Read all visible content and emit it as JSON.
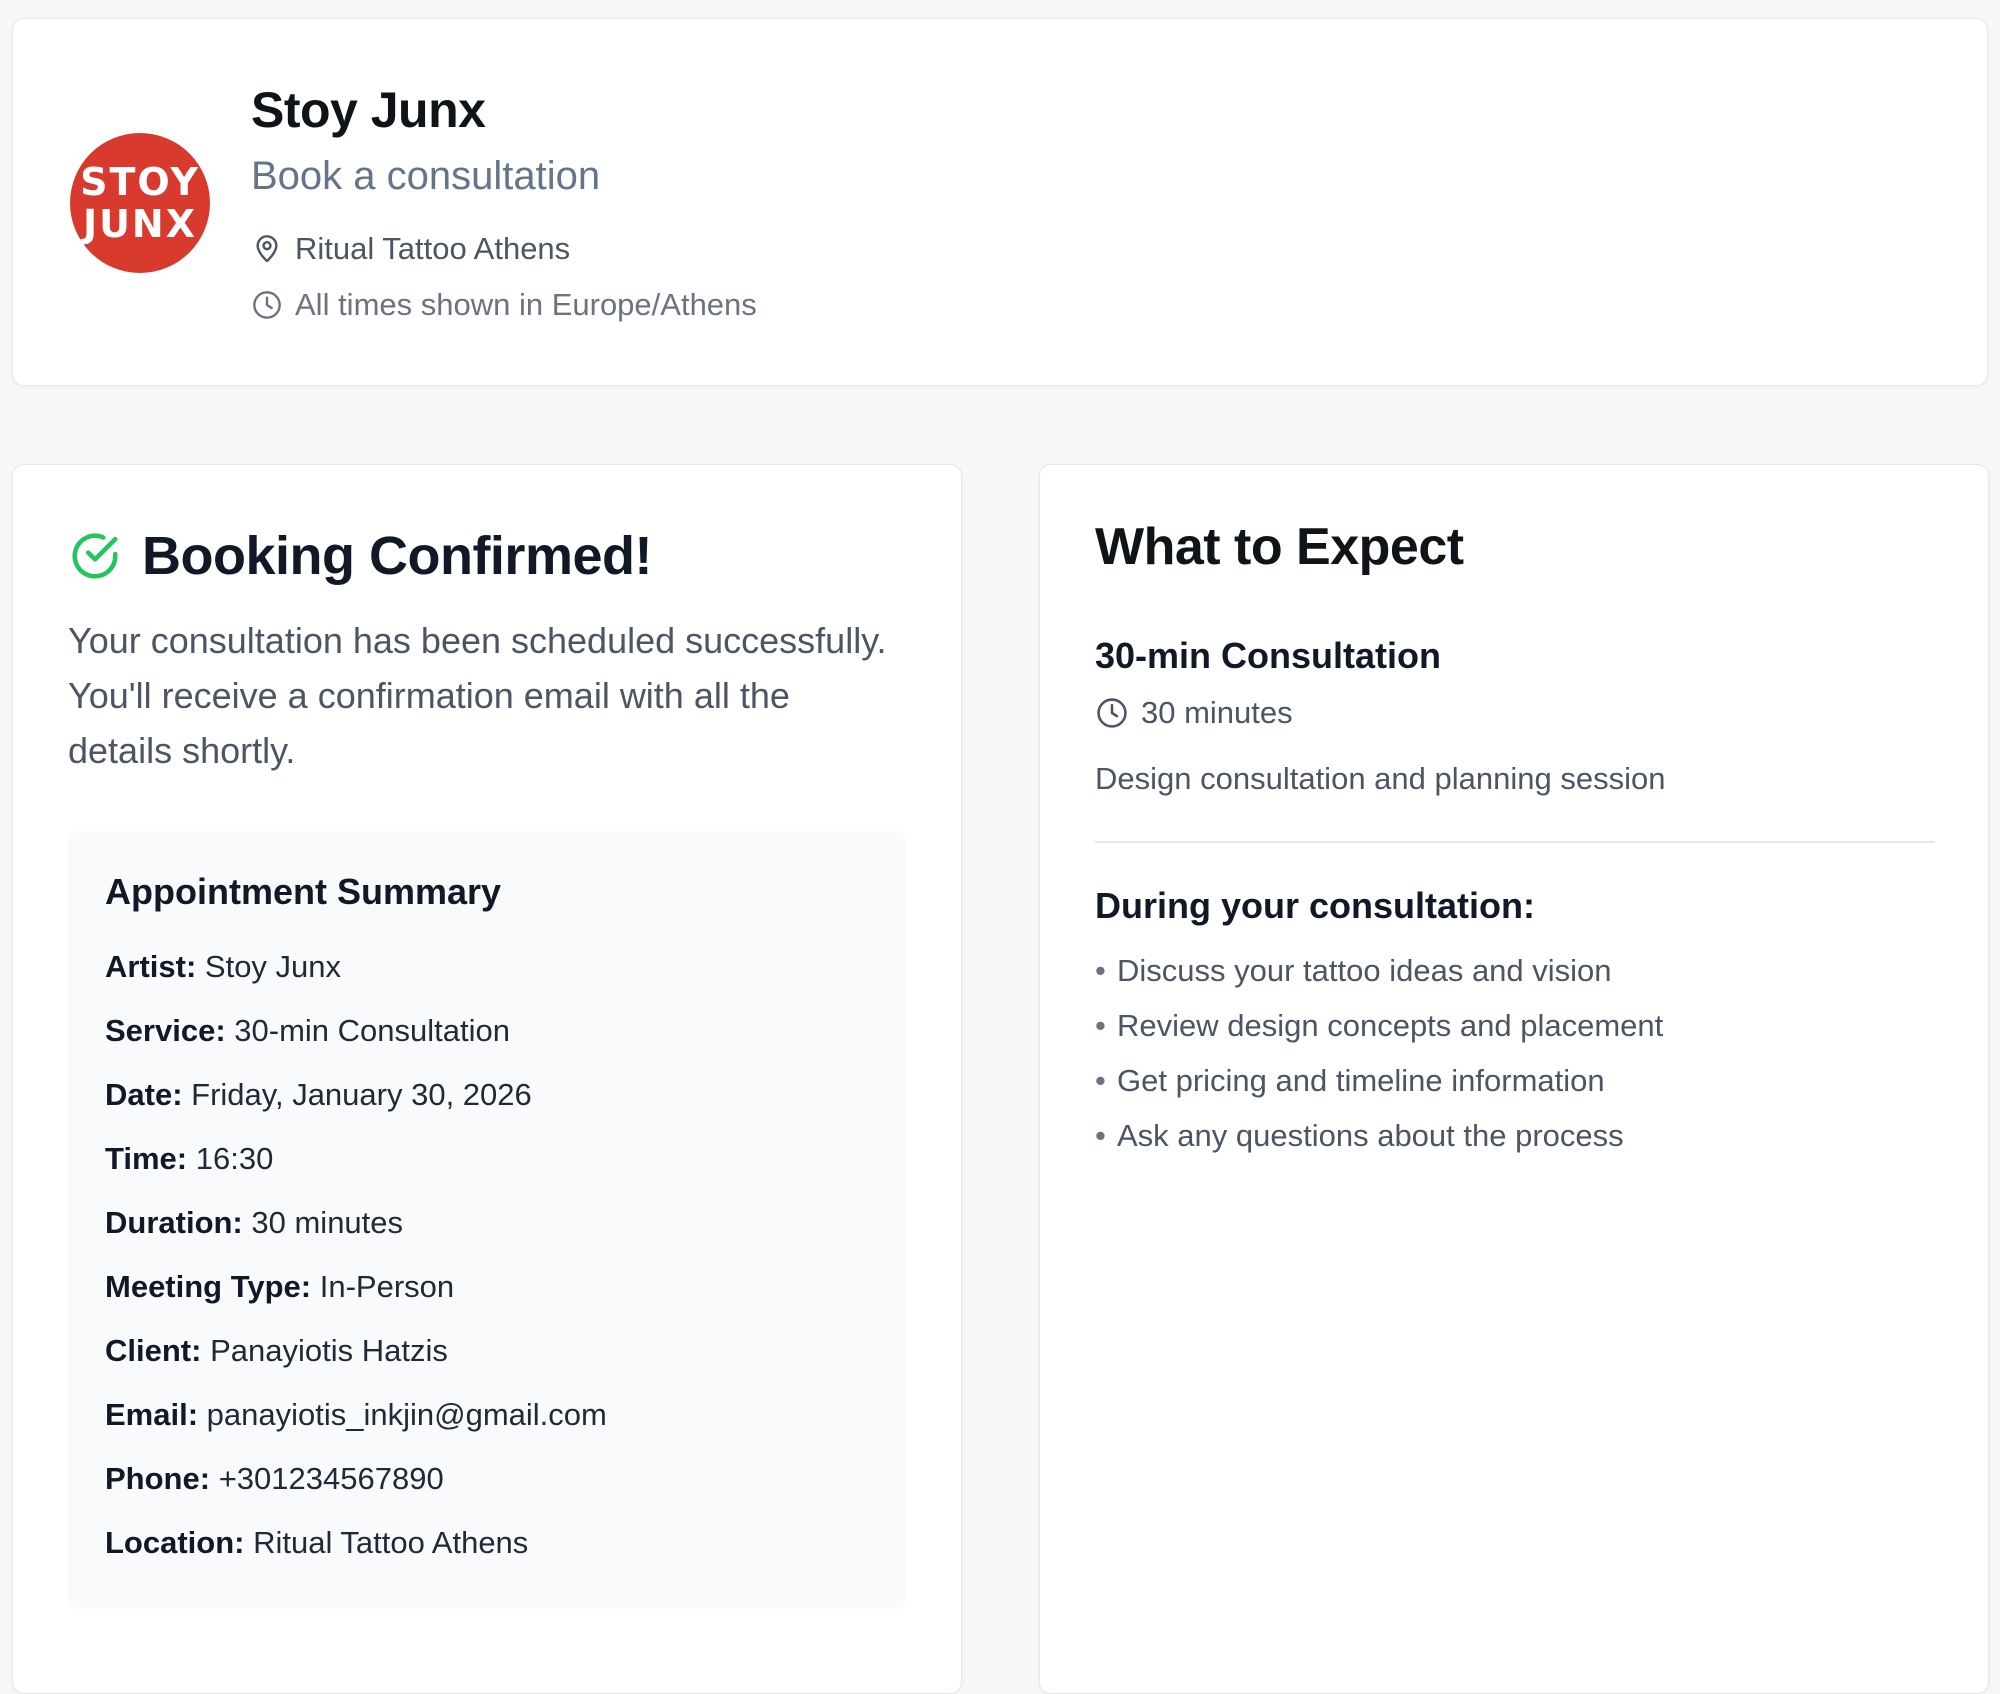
{
  "header": {
    "logo_lines": [
      "STOY",
      "JUNX"
    ],
    "title": "Stoy Junx",
    "subtitle": "Book a consultation",
    "location": "Ritual Tattoo Athens",
    "timezone_note": "All times shown in Europe/Athens"
  },
  "confirmation": {
    "title": "Booking Confirmed!",
    "message": "Your consultation has been scheduled successfully. You'll receive a confirmation email with all the details shortly."
  },
  "summary": {
    "title": "Appointment Summary",
    "rows": [
      {
        "label": "Artist:",
        "value": "Stoy Junx"
      },
      {
        "label": "Service:",
        "value": "30-min Consultation"
      },
      {
        "label": "Date:",
        "value": "Friday, January 30, 2026"
      },
      {
        "label": "Time:",
        "value": "16:30"
      },
      {
        "label": "Duration:",
        "value": "30 minutes"
      },
      {
        "label": "Meeting Type:",
        "value": "In-Person"
      },
      {
        "label": "Client:",
        "value": "Panayiotis Hatzis"
      },
      {
        "label": "Email:",
        "value": "panayiotis_inkjin@gmail.com"
      },
      {
        "label": "Phone:",
        "value": "+301234567890"
      },
      {
        "label": "Location:",
        "value": "Ritual Tattoo Athens"
      }
    ]
  },
  "expect": {
    "title": "What to Expect",
    "service_name": "30-min Consultation",
    "duration": "30 minutes",
    "description": "Design consultation and planning session",
    "during_title": "During your consultation:",
    "bullets": [
      "Discuss your tattoo ideas and vision",
      "Review design concepts and placement",
      "Get pricing and timeline information",
      "Ask any questions about the process"
    ]
  },
  "colors": {
    "logo_red": "#d93a2e",
    "success_green": "#22c55e",
    "muted_text": "#64748b",
    "page_background": "#f6f7f9"
  },
  "icons": {
    "location": "map-pin-icon",
    "timezone": "clock-icon",
    "confirmed": "check-circle-icon",
    "duration": "clock-icon"
  }
}
